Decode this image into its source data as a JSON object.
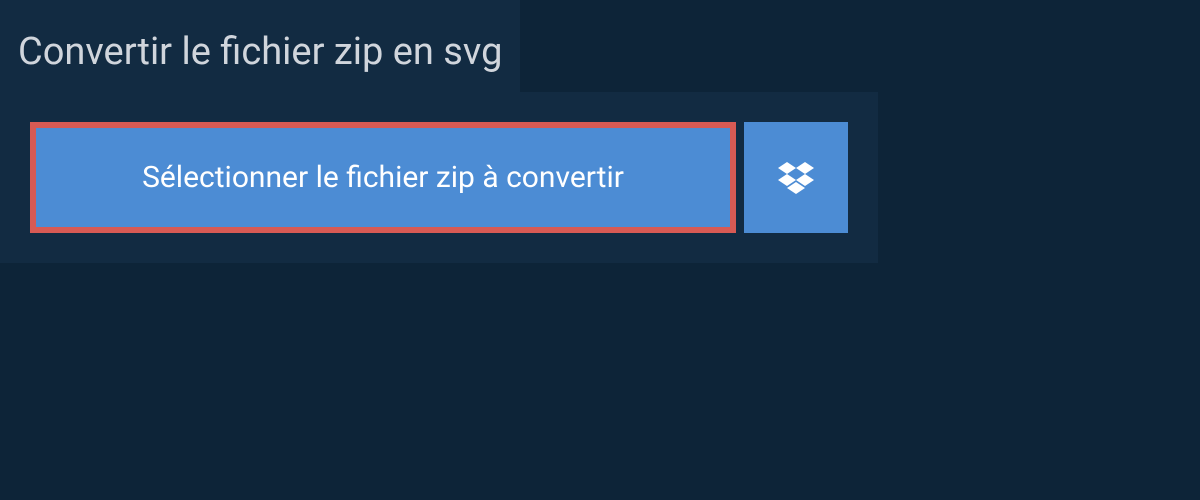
{
  "header": {
    "title": "Convertir le fichier zip en svg"
  },
  "upload": {
    "select_button_label": "Sélectionner le fichier zip à convertir"
  },
  "colors": {
    "background_dark": "#0d2438",
    "panel": "#122b42",
    "button_primary": "#4c8cd4",
    "button_highlight_border": "#d75a54",
    "text_light": "#d0d5dc",
    "text_white": "#ffffff"
  }
}
